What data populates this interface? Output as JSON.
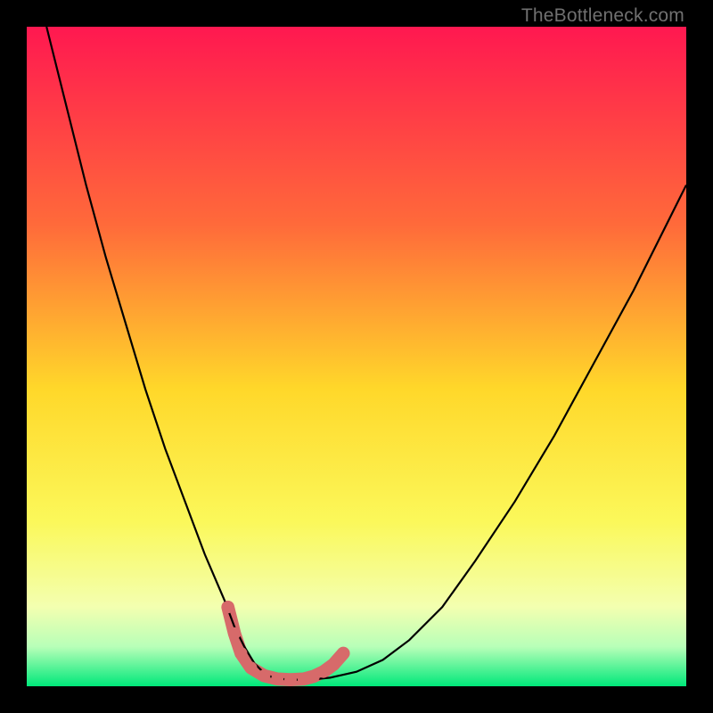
{
  "watermark": "TheBottleneck.com",
  "chart_data": {
    "type": "line",
    "title": "",
    "xlabel": "",
    "ylabel": "",
    "xlim": [
      0,
      100
    ],
    "ylim": [
      0,
      100
    ],
    "gradient_stops": [
      {
        "offset": 0,
        "color": "#ff1850"
      },
      {
        "offset": 30,
        "color": "#ff6a3a"
      },
      {
        "offset": 55,
        "color": "#ffd82a"
      },
      {
        "offset": 75,
        "color": "#fbf85a"
      },
      {
        "offset": 88,
        "color": "#f3ffb0"
      },
      {
        "offset": 94,
        "color": "#b8ffb8"
      },
      {
        "offset": 100,
        "color": "#00e87a"
      }
    ],
    "series": [
      {
        "name": "bottleneck-curve",
        "color": "#000000",
        "x": [
          3,
          6,
          9,
          12,
          15,
          18,
          21,
          24,
          27,
          30,
          31.5,
          33,
          34.5,
          36,
          37.5,
          40,
          43,
          46,
          50,
          54,
          58,
          63,
          68,
          74,
          80,
          86,
          92,
          97,
          100
        ],
        "y": [
          100,
          88,
          76,
          65,
          55,
          45,
          36,
          28,
          20,
          13,
          9,
          6,
          3.5,
          2,
          1.2,
          1,
          1,
          1.3,
          2.2,
          4,
          7,
          12,
          19,
          28,
          38,
          49,
          60,
          70,
          76
        ]
      }
    ],
    "markers": {
      "name": "highlight-dots",
      "color": "#d76a6a",
      "radius": 7,
      "points": [
        {
          "x": 30.5,
          "y": 12
        },
        {
          "x": 31.5,
          "y": 8
        },
        {
          "x": 32.5,
          "y": 5
        },
        {
          "x": 34,
          "y": 2.8
        },
        {
          "x": 36,
          "y": 1.6
        },
        {
          "x": 38,
          "y": 1.1
        },
        {
          "x": 40,
          "y": 1
        },
        {
          "x": 42,
          "y": 1.1
        },
        {
          "x": 43.5,
          "y": 1.5
        },
        {
          "x": 45,
          "y": 2.2
        },
        {
          "x": 46.5,
          "y": 3.3
        },
        {
          "x": 48,
          "y": 5
        }
      ]
    }
  }
}
